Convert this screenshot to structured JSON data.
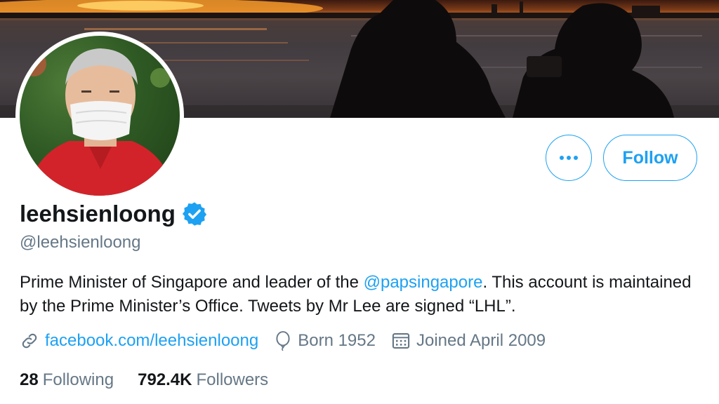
{
  "profile": {
    "display_name": "leehsienloong",
    "handle": "@leehsienloong",
    "bio": {
      "part1": "Prime Minister of Singapore and leader of the ",
      "mention": "@papsingapore",
      "part2": ". This account is maintained by the Prime Minister’s Office. Tweets by Mr Lee are signed “LHL”."
    },
    "website": "facebook.com/leehsienloong",
    "born": "Born 1952",
    "joined": "Joined April 2009",
    "following_count": "28",
    "following_label": "Following",
    "followers_count": "792.4K",
    "followers_label": "Followers"
  },
  "actions": {
    "follow_label": "Follow"
  },
  "colors": {
    "accent": "#1da1f2",
    "muted": "#657786",
    "text": "#14171a"
  },
  "icons": [
    "link-icon",
    "balloon-icon",
    "calendar-icon",
    "verified-badge-icon",
    "more-dots-icon"
  ]
}
